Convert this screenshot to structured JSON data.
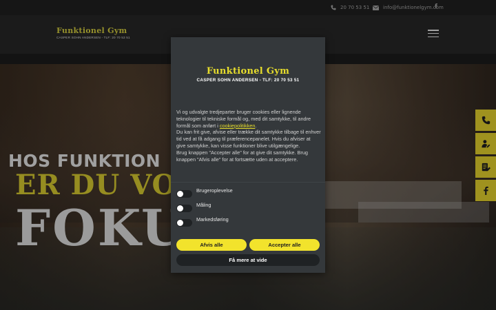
{
  "topbar": {
    "phone": "20 70 53 51",
    "email": "info@funktionelgym.com",
    "social": "f"
  },
  "header": {
    "logo_title": "Funktionel Gym",
    "logo_subtitle": "CASPER SOHN ANDERSEN - TLF: 20 70 53 51"
  },
  "hero": {
    "line1": "HOS FUNKTION",
    "line2": "ER DU VO",
    "line3": "FOKU"
  },
  "side_buttons": [
    "phone-icon",
    "user-edit-icon",
    "form-icon",
    "facebook-icon"
  ],
  "cookie": {
    "logo_title": "Funktionel Gym",
    "logo_subtitle": "CASPER SOHN ANDERSEN - TLF: 20 70 53 51",
    "text_before_link": "Vi og udvalgte tredjeparter bruger cookies eller lignende teknologier til tekniske formål og, med dit samtykke, til andre formål som anført i ",
    "link": "cookiepolitikken",
    "text_after_link": ".",
    "text_p2": "Du kan frit give, afvise eller trække dit samtykke tilbage til enhver tid ved at få adgang til præferencepanelet. Hvis du afviser at give samtykke, kan visse funktioner blive utilgængelige.",
    "text_p3": "Brug knappen \"Accepter alle\" for at give dit samtykke. Brug knappen \"Afvis alle\" for at fortsætte uden at acceptere.",
    "options": [
      "Brugeroplevelse",
      "Måling",
      "Markedsføring"
    ],
    "reject_label": "Afvis alle",
    "accept_label": "Accepter alle",
    "more_label": "Få mere at vide"
  },
  "colors": {
    "accent": "#f2e32c",
    "modal_bg": "#34383b",
    "side_button": "#d4c32a"
  }
}
